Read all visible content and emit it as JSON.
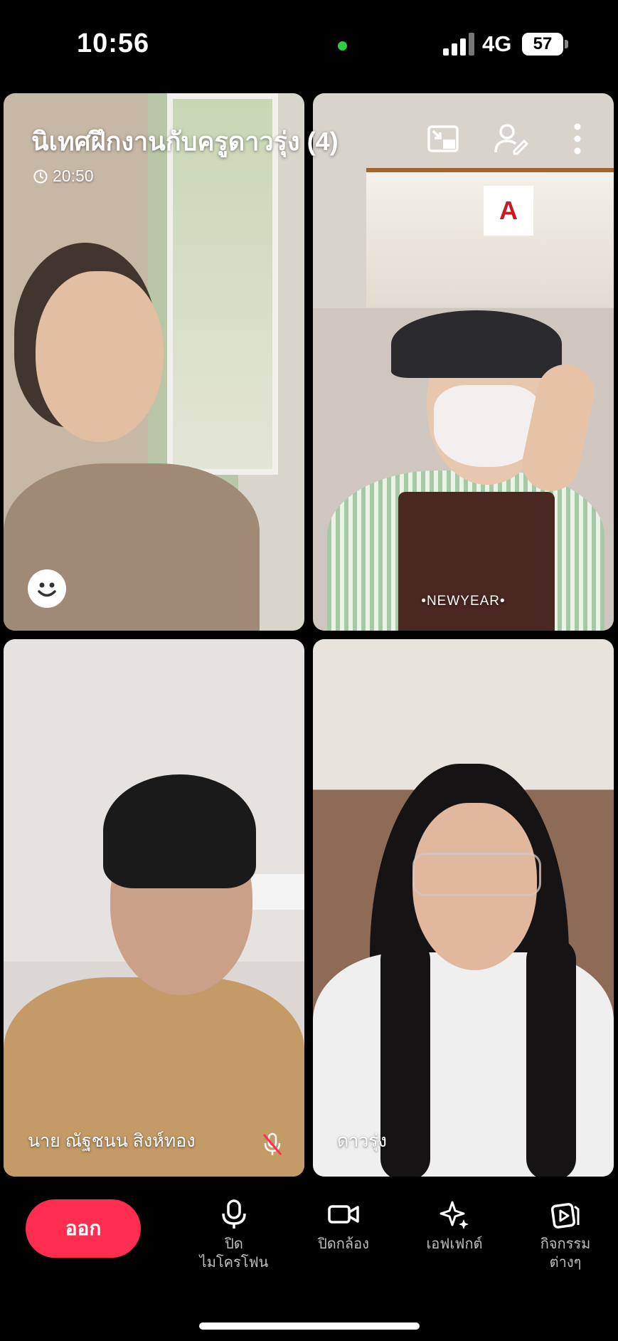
{
  "status_bar": {
    "time": "10:56",
    "network": "4G",
    "battery": "57"
  },
  "call": {
    "title": "นิเทศฝึกงานกับครูดาวรุ่ง (4)",
    "duration": "20:50"
  },
  "header_icons": [
    "picture-in-picture-icon",
    "add-participant-icon",
    "more-options-icon"
  ],
  "participants": [
    {
      "name": "",
      "reaction_icon": "smile-icon"
    },
    {
      "name": "",
      "overlay_text": "•NEWYEAR•"
    },
    {
      "name": "นาย ณัฐชนน สิงห์ทอง",
      "muted": true
    },
    {
      "name": "ดาวรุ่ง"
    }
  ],
  "toolbar": {
    "leave_label": "ออก",
    "mic_label_line1": "ปิด",
    "mic_label_line2": "ไมโครโฟน",
    "camera_label": "ปิดกล้อง",
    "effects_label": "เอฟเฟกต์",
    "activities_label_line1": "กิจกรรม",
    "activities_label_line2": "ต่างๆ"
  },
  "colors": {
    "leave_button": "#ff2d4f",
    "camera_indicator": "#2ecc40",
    "background": "#000000"
  }
}
